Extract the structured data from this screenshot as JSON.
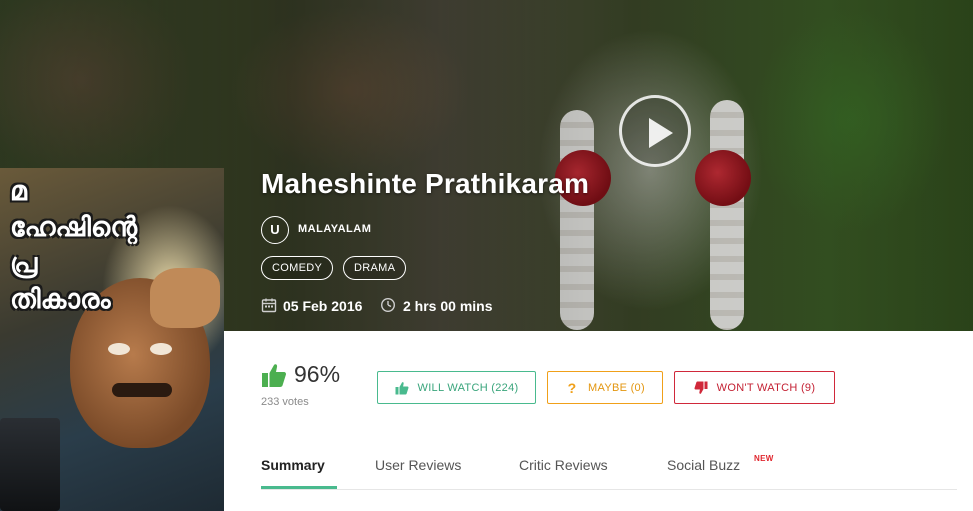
{
  "movie": {
    "title": "Maheshinte Prathikaram",
    "certificate": "U",
    "language": "MALAYALAM",
    "genres": [
      "COMEDY",
      "DRAMA"
    ],
    "release_date": "05 Feb 2016",
    "duration": "2 hrs 00 mins",
    "poster_title_text": "മഹേഷിന്റെ പ്രതികാരം"
  },
  "rating": {
    "percent": "96%",
    "votes": "233 votes"
  },
  "actions": {
    "will_watch": "WILL WATCH (224)",
    "maybe": "MAYBE (0)",
    "wont_watch": "WON'T WATCH (9)"
  },
  "tabs": [
    {
      "label": "Summary",
      "active": true
    },
    {
      "label": "User Reviews",
      "active": false
    },
    {
      "label": "Critic Reviews",
      "active": false
    },
    {
      "label": "Social Buzz",
      "active": false,
      "badge": "NEW"
    }
  ],
  "icons": {
    "play": "play-icon",
    "calendar": "calendar-icon",
    "clock": "clock-icon",
    "thumb_up": "thumbs-up-icon",
    "question": "question-icon",
    "thumb_down": "thumbs-down-icon"
  },
  "colors": {
    "green": "#49ba8e",
    "thumb_green": "#4caf50",
    "maybe_orange": "#f0a019",
    "wont_red": "#d0283a"
  }
}
